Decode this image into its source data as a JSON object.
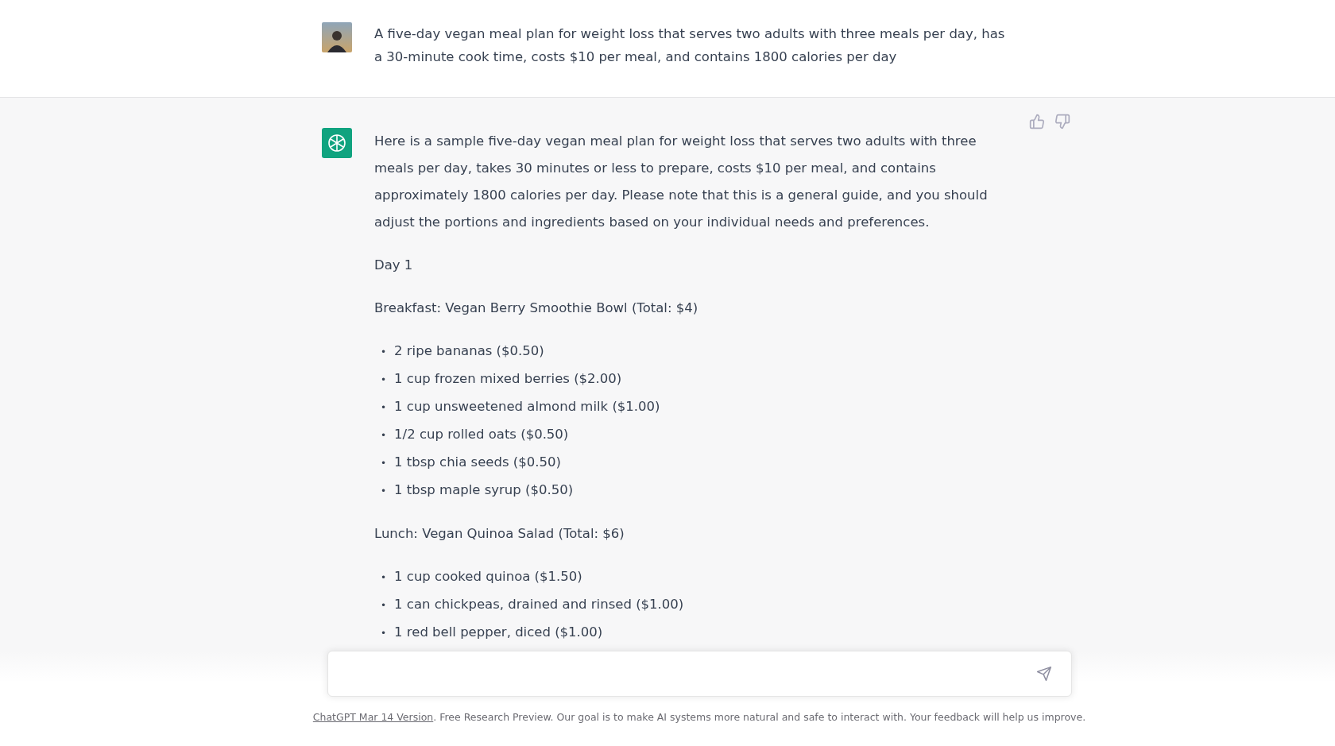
{
  "user_message": {
    "text": "A five-day vegan meal plan for weight loss that serves two adults with three meals per day, has a 30-minute cook time, costs $10 per meal, and contains 1800 calories per day"
  },
  "assistant_message": {
    "blocks": [
      {
        "kind": "paragraph",
        "text": "Here is a sample five-day vegan meal plan for weight loss that serves two adults with three meals per day, takes 30 minutes or less to prepare, costs $10 per meal, and contains approximately 1800 calories per day. Please note that this is a general guide, and you should adjust the portions and ingredients based on your individual needs and preferences."
      },
      {
        "kind": "paragraph",
        "text": "Day 1"
      },
      {
        "kind": "paragraph",
        "text": "Breakfast: Vegan Berry Smoothie Bowl (Total: $4)"
      },
      {
        "kind": "list",
        "marker": "•",
        "items": [
          "2 ripe bananas ($0.50)",
          "1 cup frozen mixed berries ($2.00)",
          "1 cup unsweetened almond milk ($1.00)",
          "1/2 cup rolled oats ($0.50)",
          "1 tbsp chia seeds ($0.50)",
          "1 tbsp maple syrup ($0.50)"
        ]
      },
      {
        "kind": "paragraph",
        "text": "Lunch: Vegan Quinoa Salad (Total: $6)"
      },
      {
        "kind": "list",
        "marker": "•",
        "items": [
          "1 cup cooked quinoa ($1.50)",
          "1 can chickpeas, drained and rinsed ($1.00)",
          "1 red bell pepper, diced ($1.00)"
        ]
      }
    ]
  },
  "footer": {
    "link": "ChatGPT Mar 14 Version",
    "text": ". Free Research Preview. Our goal is to make AI systems more natural and safe to interact with. Your feedback will help us improve."
  }
}
